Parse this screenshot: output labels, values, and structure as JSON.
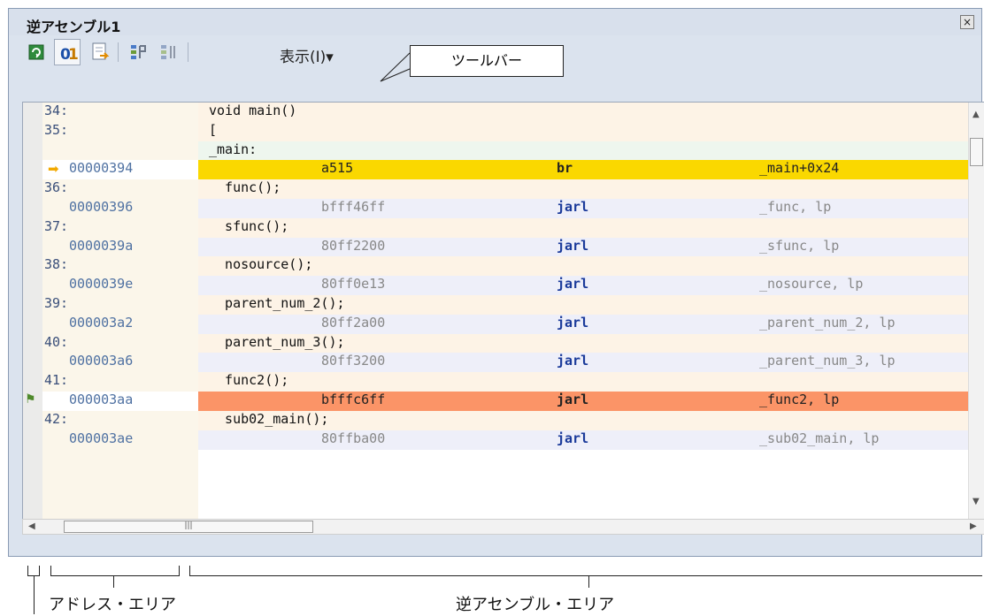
{
  "window": {
    "title": "逆アセンブル1",
    "close": "×"
  },
  "toolbar": {
    "view_menu": "表示(I)▾"
  },
  "callout_toolbar": "ツールバー",
  "labels": {
    "address_area": "アドレス・エリア",
    "disasm_area": "逆アセンブル・エリア"
  },
  "rows": [
    {
      "type": "src",
      "line": "34:",
      "text": "void main()"
    },
    {
      "type": "src",
      "line": "35:",
      "text": "["
    },
    {
      "type": "label",
      "text": "_main:"
    },
    {
      "type": "ins",
      "addr": "00000394",
      "code": "a515",
      "mnem": "br",
      "oper": "_main+0x24",
      "highlight": "yellow",
      "marker": "pc"
    },
    {
      "type": "src",
      "line": "36:",
      "text": "  func();"
    },
    {
      "type": "ins",
      "addr": "00000396",
      "code": "bfff46ff",
      "mnem": "jarl",
      "oper": "_func, lp"
    },
    {
      "type": "src",
      "line": "37:",
      "text": "  sfunc();"
    },
    {
      "type": "ins",
      "addr": "0000039a",
      "code": "80ff2200",
      "mnem": "jarl",
      "oper": "_sfunc, lp"
    },
    {
      "type": "src",
      "line": "38:",
      "text": "  nosource();"
    },
    {
      "type": "ins",
      "addr": "0000039e",
      "code": "80ff0e13",
      "mnem": "jarl",
      "oper": "_nosource, lp"
    },
    {
      "type": "src",
      "line": "39:",
      "text": "  parent_num_2();"
    },
    {
      "type": "ins",
      "addr": "000003a2",
      "code": "80ff2a00",
      "mnem": "jarl",
      "oper": "_parent_num_2, lp"
    },
    {
      "type": "src",
      "line": "40:",
      "text": "  parent_num_3();"
    },
    {
      "type": "ins",
      "addr": "000003a6",
      "code": "80ff3200",
      "mnem": "jarl",
      "oper": "_parent_num_3, lp"
    },
    {
      "type": "src",
      "line": "41:",
      "text": "  func2();"
    },
    {
      "type": "ins",
      "addr": "000003aa",
      "code": "bfffc6ff",
      "mnem": "jarl",
      "oper": "_func2, lp",
      "highlight": "orange",
      "marker": "break"
    },
    {
      "type": "src",
      "line": "42:",
      "text": "  sub02_main();"
    },
    {
      "type": "ins",
      "addr": "000003ae",
      "code": "80ffba00",
      "mnem": "jarl",
      "oper": "_sub02_main, lp"
    }
  ],
  "colors": {
    "row_src": "#fdf3e6",
    "row_ins": "#eeeff9",
    "row_label": "#eef6ee",
    "yellow": "#fad800",
    "orange": "#fb9467"
  },
  "icons": [
    "refresh-icon",
    "mixed-display-icon",
    "source-jump-icon",
    "step-in-icon",
    "step-over-icon"
  ]
}
